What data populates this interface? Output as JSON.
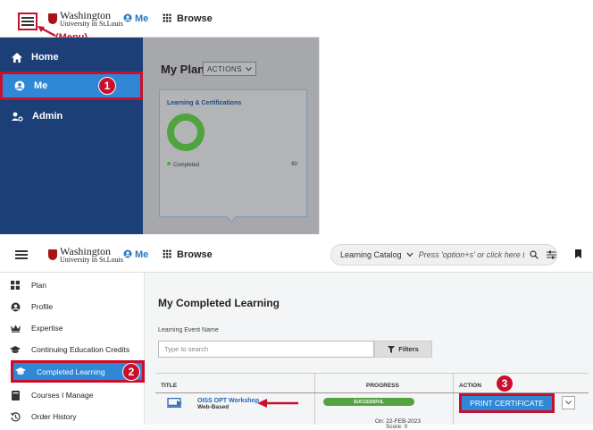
{
  "logo": {
    "line1": "Washington",
    "line2": "University in St.Louis"
  },
  "annotations": {
    "menu_label": "(Menu)",
    "step1": "1",
    "step2": "2",
    "step3": "3"
  },
  "colors": {
    "nav_blue": "#1c3f77",
    "active_blue": "#2f87d6",
    "highlight_red": "#c8102e",
    "success_green": "#55a33e"
  },
  "panel1": {
    "header": {
      "me": "Me",
      "browse": "Browse"
    },
    "sidebar": {
      "items": [
        {
          "label": "Home",
          "icon": "home-icon"
        },
        {
          "label": "Me",
          "icon": "user-circle-icon",
          "active": true
        },
        {
          "label": "Admin",
          "icon": "admin-icon"
        }
      ]
    },
    "main": {
      "title": "My Plan",
      "actions_label": "ACTIONS",
      "card": {
        "title": "Learning & Certifications",
        "legend_label": "Completed",
        "count": "60",
        "completed_fraction": 1.0
      }
    }
  },
  "panel2": {
    "header": {
      "me": "Me",
      "browse": "Browse",
      "catalog_label": "Learning Catalog",
      "search_placeholder": "Press 'option+s' or click here to s"
    },
    "sidebar": {
      "items": [
        {
          "label": "Plan",
          "icon": "plan-grid-icon"
        },
        {
          "label": "Profile",
          "icon": "user-circle-icon"
        },
        {
          "label": "Expertise",
          "icon": "crown-icon"
        },
        {
          "label": "Continuing Education Credits",
          "icon": "graduation-cap-icon"
        },
        {
          "label": "Completed Learning",
          "icon": "graduation-cap-icon",
          "active": true
        },
        {
          "label": "Courses I Manage",
          "icon": "book-icon"
        },
        {
          "label": "Order History",
          "icon": "history-icon"
        }
      ]
    },
    "main": {
      "title": "My Completed Learning",
      "filter_label": "Learning Event Name",
      "filter_placeholder": "Type to search",
      "filters_button": "Filters",
      "table": {
        "headers": {
          "title": "TITLE",
          "progress": "PROGRESS",
          "action": "ACTION"
        },
        "rows": [
          {
            "title": "OISS OPT Workshop",
            "type": "Web-Based",
            "progress_label": "SUCCESSFUL",
            "date": "On: 22-FEB-2023",
            "score": "Score: 0",
            "action": "PRINT CERTIFICATE"
          }
        ]
      }
    }
  }
}
